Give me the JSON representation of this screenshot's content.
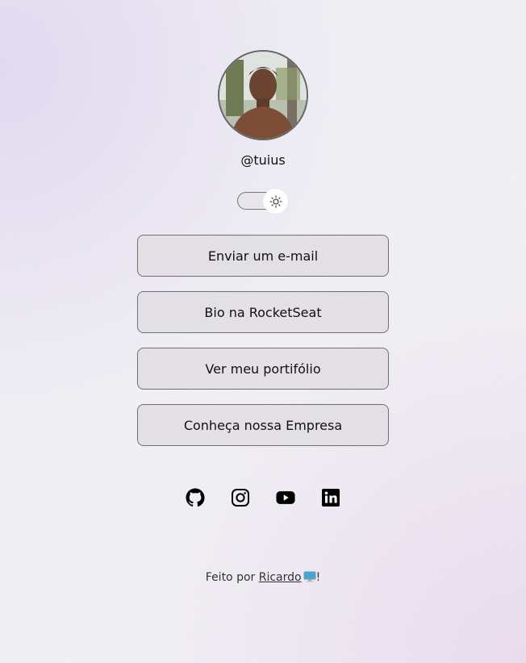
{
  "profile": {
    "username": "@tuius",
    "avatar_alt": "photo of a person outdoors"
  },
  "theme_switch": {
    "icon": "sun-icon"
  },
  "links": [
    {
      "label": "Enviar um e-mail"
    },
    {
      "label": "Bio na RocketSeat"
    },
    {
      "label": "Ver meu portifólio"
    },
    {
      "label": "Conheça nossa Empresa"
    }
  ],
  "social": [
    {
      "name": "github-icon"
    },
    {
      "name": "instagram-icon"
    },
    {
      "name": "youtube-icon"
    },
    {
      "name": "linkedin-icon"
    }
  ],
  "footer": {
    "prefix": "Feito por ",
    "author": "Ricardo",
    "suffix": "!"
  },
  "colors": {
    "background": "#f2f1f6",
    "button_bg": "#e0dde2",
    "button_border": "#6f6f6f",
    "text": "#111111"
  }
}
